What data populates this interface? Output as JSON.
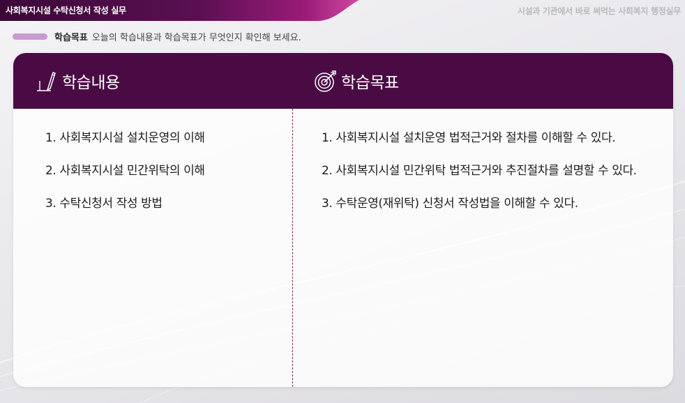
{
  "header": {
    "course_title": "사회복지시설 수탁신청서 작성 실무",
    "series_title": "시설과 기관에서 바로 써먹는 사회복지 행정실무"
  },
  "goal_bar": {
    "label": "학습목표",
    "description": "오늘의 학습내용과 학습목표가 무엇인지 확인해 보세요."
  },
  "content": {
    "title": "학습내용",
    "items": [
      "1. 사회복지시설 설치운영의 이해",
      "2. 사회복지시설 민간위탁의 이해",
      "3. 수탁신청서 작성 방법"
    ]
  },
  "objectives": {
    "title": "학습목표",
    "items": [
      "1. 사회복지시설 설치운영 법적근거와 절차를 이해할 수 있다.",
      "2. 사회복지시설 민간위탁 법적근거와 추진절차를 설명할 수 있다.",
      "3. 수탁운영(재위탁) 신청서 작성법을 이해할 수 있다."
    ]
  },
  "colors": {
    "header_purple": "#4a0b45",
    "accent_pink": "#c89ad0",
    "tab_magenta": "#8a1a6e"
  },
  "icons": {
    "content_icon": "pen-paper-icon",
    "objectives_icon": "target-arrow-icon"
  }
}
